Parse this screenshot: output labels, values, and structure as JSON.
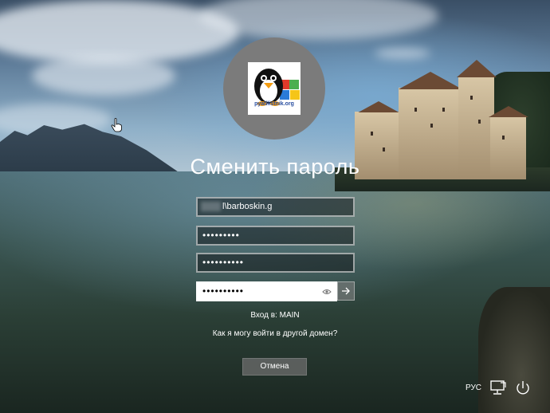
{
  "login": {
    "heading": "Сменить пароль",
    "username_visible": "l\\barboskin.g",
    "old_password_mask": "•••••••••",
    "new_password_mask": "••••••••••",
    "confirm_password_mask": "••••••••••",
    "domain_text": "Вход в: MAIN",
    "other_domain_link": "Как я могу войти в другой домен?",
    "cancel_label": "Отмена"
  },
  "avatar": {
    "logo_text": "pyatilistnik.org"
  },
  "system_tray": {
    "language": "РУС",
    "network_icon": "network-icon",
    "power_icon": "power-icon"
  },
  "icons": {
    "reveal": "eye-icon",
    "submit": "arrow-right-icon",
    "cursor": "hand-cursor-icon"
  }
}
